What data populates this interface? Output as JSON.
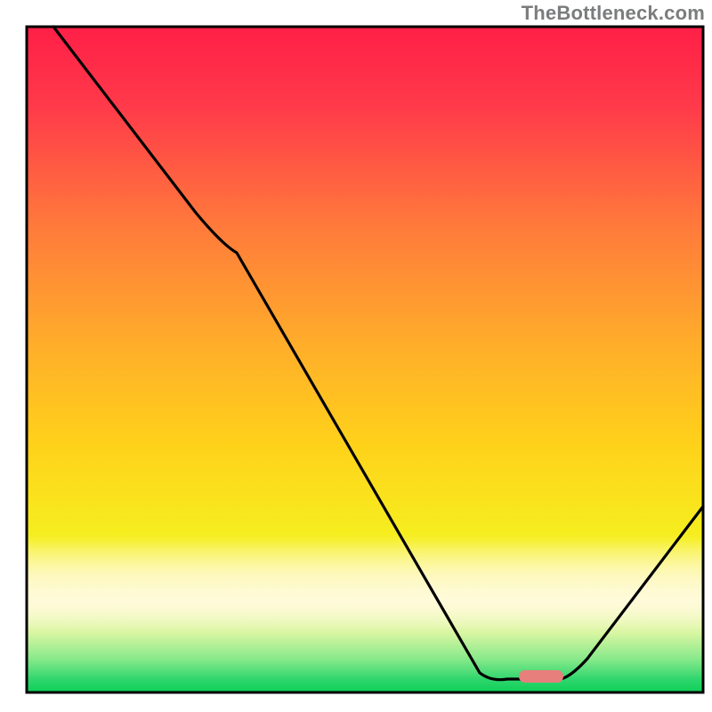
{
  "watermark": "TheBottleneck.com",
  "chart_data": {
    "type": "line",
    "title": "",
    "xlabel": "",
    "ylabel": "",
    "xlim": [
      0,
      100
    ],
    "ylim": [
      0,
      100
    ],
    "grid": false,
    "legend": false,
    "colors": {
      "line": "#000000",
      "marker_fill": "#e77f7d",
      "gradient_top": "#ff1f47",
      "gradient_mid": "#ffd21a",
      "gradient_bottom": "#0dcf56",
      "gradient_overlay_cream": "#fff9db"
    },
    "marker": {
      "x": 76,
      "y": 2.5
    },
    "x": [
      4,
      25,
      31,
      67,
      71,
      79,
      100
    ],
    "y": [
      100,
      72,
      66,
      3,
      2,
      2,
      28
    ],
    "comment": "y values read as approximate percentage height from the bottom of the plot box; x values as approximate percentage along the width."
  }
}
